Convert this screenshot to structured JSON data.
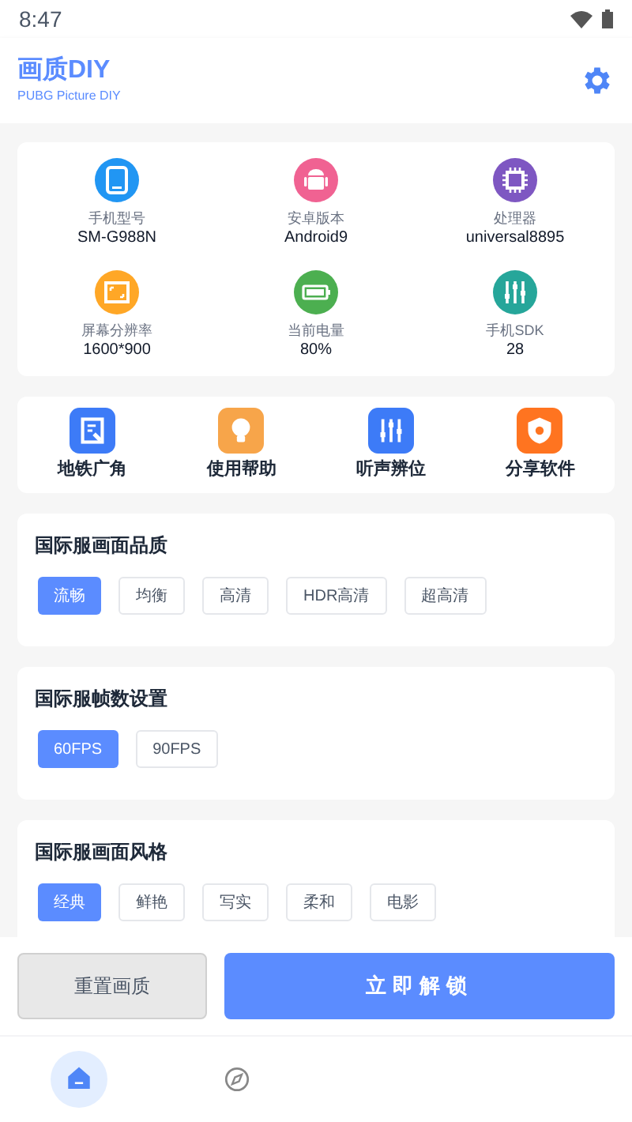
{
  "status_bar": {
    "time": "8:47"
  },
  "header": {
    "title": "画质DIY",
    "subtitle": "PUBG Picture DIY"
  },
  "device_info": [
    {
      "kind": "phone",
      "color": "#2196f3",
      "label": "手机型号",
      "value": "SM-G988N"
    },
    {
      "kind": "android",
      "color": "#f06292",
      "label": "安卓版本",
      "value": "Android9"
    },
    {
      "kind": "chip",
      "color": "#7e57c2",
      "label": "处理器",
      "value": "universal8895"
    },
    {
      "kind": "screen",
      "color": "#ffa726",
      "label": "屏幕分辨率",
      "value": "1600*900"
    },
    {
      "kind": "battery",
      "color": "#4caf50",
      "label": "当前电量",
      "value": "80%"
    },
    {
      "kind": "sliders",
      "color": "#26a69a",
      "label": "手机SDK",
      "value": "28"
    }
  ],
  "tools": [
    {
      "kind": "edit",
      "color": "#3d7bf7",
      "label": "地铁广角"
    },
    {
      "kind": "bulb",
      "color": "#f7a54a",
      "label": "使用帮助"
    },
    {
      "kind": "sliders",
      "color": "#3d7bf7",
      "label": "听声辨位"
    },
    {
      "kind": "shield",
      "color": "#ff7420",
      "label": "分享软件"
    }
  ],
  "sections": [
    {
      "title": "国际服画面品质",
      "options": [
        {
          "label": "流畅",
          "selected": true
        },
        {
          "label": "均衡",
          "selected": false
        },
        {
          "label": "高清",
          "selected": false
        },
        {
          "label": "HDR高清",
          "selected": false
        },
        {
          "label": "超高清",
          "selected": false
        }
      ]
    },
    {
      "title": "国际服帧数设置",
      "options": [
        {
          "label": "60FPS",
          "selected": true
        },
        {
          "label": "90FPS",
          "selected": false
        }
      ]
    },
    {
      "title": "国际服画面风格",
      "options": [
        {
          "label": "经典",
          "selected": true
        },
        {
          "label": "鲜艳",
          "selected": false
        },
        {
          "label": "写实",
          "selected": false
        },
        {
          "label": "柔和",
          "selected": false
        },
        {
          "label": "电影",
          "selected": false
        }
      ]
    }
  ],
  "actions": {
    "reset": "重置画质",
    "unlock": "立即解锁"
  },
  "nav": [
    {
      "kind": "home",
      "selected": true
    },
    {
      "kind": "compass",
      "selected": false
    }
  ]
}
